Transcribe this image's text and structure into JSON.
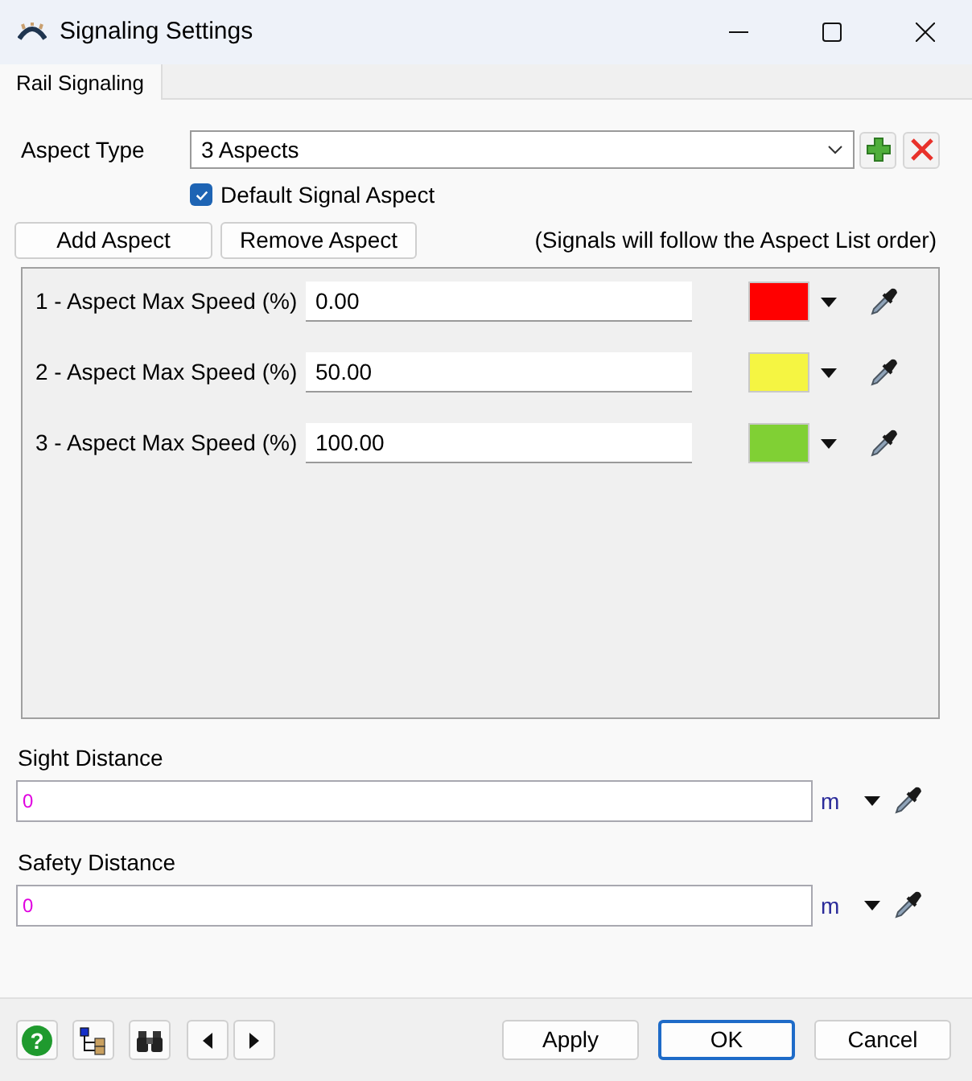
{
  "window": {
    "title": "Signaling Settings"
  },
  "tabs": [
    {
      "label": "Rail Signaling",
      "selected": true
    }
  ],
  "aspect_type": {
    "label": "Aspect Type",
    "value": "3 Aspects"
  },
  "default_signal_aspect": {
    "label": "Default Signal Aspect",
    "checked": true
  },
  "buttons": [
    "Add Aspect",
    "Remove Aspect"
  ],
  "note": "(Signals will follow the Aspect List order)",
  "aspects": [
    {
      "label": "1 - Aspect Max Speed (%)",
      "value": "0.00",
      "color": "#ff0000"
    },
    {
      "label": "2 - Aspect Max Speed (%)",
      "value": "50.00",
      "color": "#f5f542"
    },
    {
      "label": "3 - Aspect Max Speed (%)",
      "value": "100.00",
      "color": "#80d034"
    }
  ],
  "distances": [
    {
      "label": "Sight Distance",
      "value": "0",
      "unit": "m"
    },
    {
      "label": "Safety Distance",
      "value": "0",
      "unit": "m"
    }
  ],
  "footer": {
    "help_glyph": "?",
    "buttons": [
      {
        "label": "Apply",
        "default": false
      },
      {
        "label": "OK",
        "default": true
      },
      {
        "label": "Cancel",
        "default": false
      }
    ]
  }
}
